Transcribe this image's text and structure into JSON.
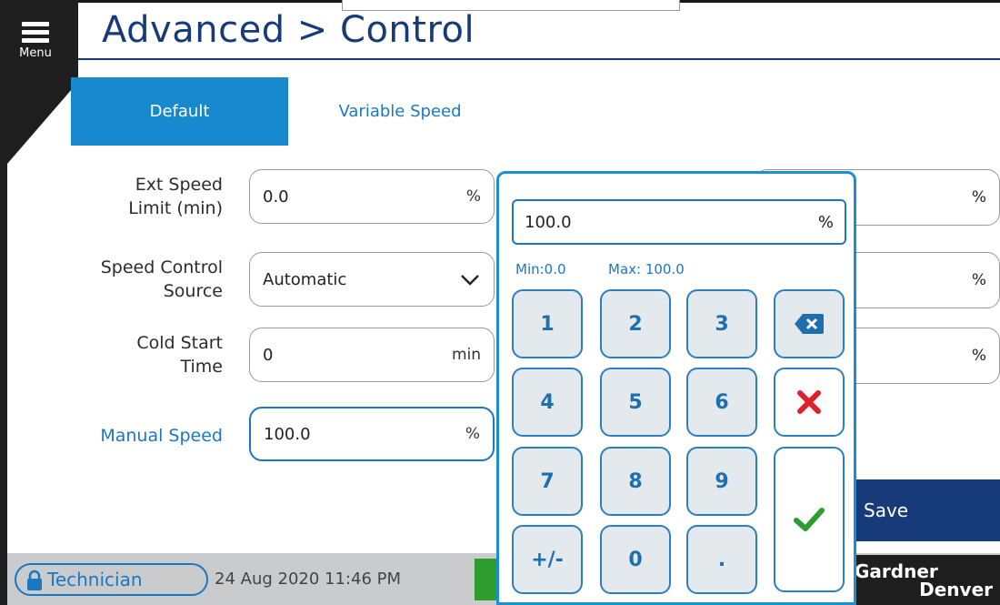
{
  "menu": {
    "label": "Menu"
  },
  "page": {
    "title": "Advanced > Control"
  },
  "tabs": [
    {
      "label": "Default",
      "active": true
    },
    {
      "label": "Variable Speed",
      "active": false
    }
  ],
  "fields": {
    "ext_speed": {
      "label_line1": "Ext Speed",
      "label_line2": "Limit (min)",
      "value": "0.0",
      "unit": "%"
    },
    "speed_control": {
      "label_line1": "Speed Control",
      "label_line2": "Source",
      "value": "Automatic"
    },
    "cold_start": {
      "label_line1": "Cold Start",
      "label_line2": "Time",
      "value": "0",
      "unit": "min"
    },
    "manual_speed": {
      "label": "Manual Speed",
      "value": "100.0",
      "unit": "%"
    }
  },
  "right_fields": [
    {
      "unit": "%"
    },
    {
      "unit": "%"
    },
    {
      "unit": "%"
    }
  ],
  "keypad": {
    "value": "100.0",
    "unit": "%",
    "min_label": "Min:0.0",
    "max_label": "Max:  100.0",
    "keys": [
      "1",
      "2",
      "3",
      "4",
      "5",
      "6",
      "7",
      "8",
      "9",
      "+/-",
      "0",
      "."
    ]
  },
  "save": {
    "label": "Save"
  },
  "status": {
    "user": "Technician",
    "datetime": "24 Aug 2020  11:46 PM"
  },
  "brand": {
    "line1": "Gardner",
    "line2": "Denver"
  },
  "colors": {
    "accent": "#1a78c2",
    "tab_active": "#1889cf",
    "title": "#173a7a",
    "keypad_border": "#1a8fd6",
    "delete": "#e0202a",
    "confirm": "#2e9c2e"
  }
}
